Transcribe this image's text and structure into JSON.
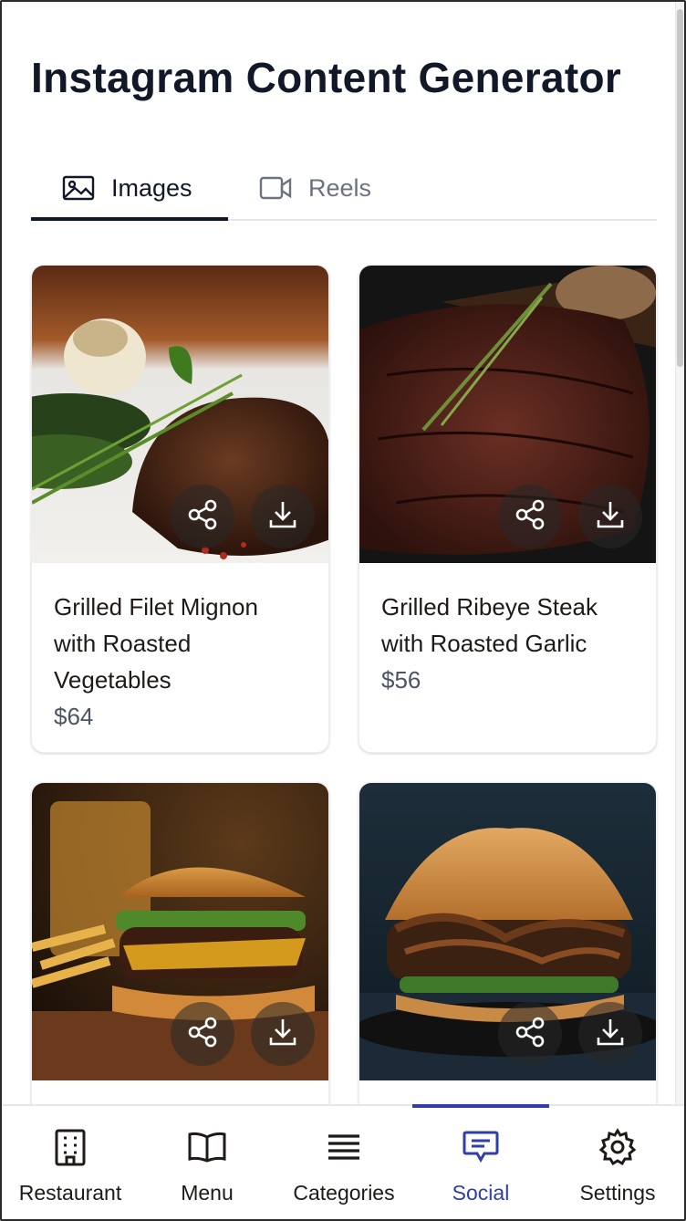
{
  "page": {
    "title": "Instagram Content Generator"
  },
  "tabs": [
    {
      "label": "Images",
      "icon": "image-icon",
      "active": true
    },
    {
      "label": "Reels",
      "icon": "video-icon",
      "active": false
    }
  ],
  "cards": [
    {
      "name": "Grilled Filet Mignon with Roasted Vegetables",
      "price": "$64",
      "image": "filet-mignon-photo"
    },
    {
      "name": "Grilled Ribeye Steak with Roasted Garlic",
      "price": "$56",
      "image": "ribeye-steak-photo"
    },
    {
      "name": "",
      "price": "",
      "image": "cheeseburger-fries-photo"
    },
    {
      "name": "",
      "price": "",
      "image": "mushroom-onion-burger-photo"
    }
  ],
  "card_actions": [
    "share-icon",
    "download-icon"
  ],
  "bottom_nav": [
    {
      "label": "Restaurant",
      "icon": "building-icon",
      "active": false
    },
    {
      "label": "Menu",
      "icon": "book-icon",
      "active": false
    },
    {
      "label": "Categories",
      "icon": "list-icon",
      "active": false
    },
    {
      "label": "Social",
      "icon": "message-icon",
      "active": true
    },
    {
      "label": "Settings",
      "icon": "gear-icon",
      "active": false
    }
  ],
  "colors": {
    "accent": "#2f3ea8",
    "text_primary": "#111827",
    "text_muted": "#6b7280"
  }
}
